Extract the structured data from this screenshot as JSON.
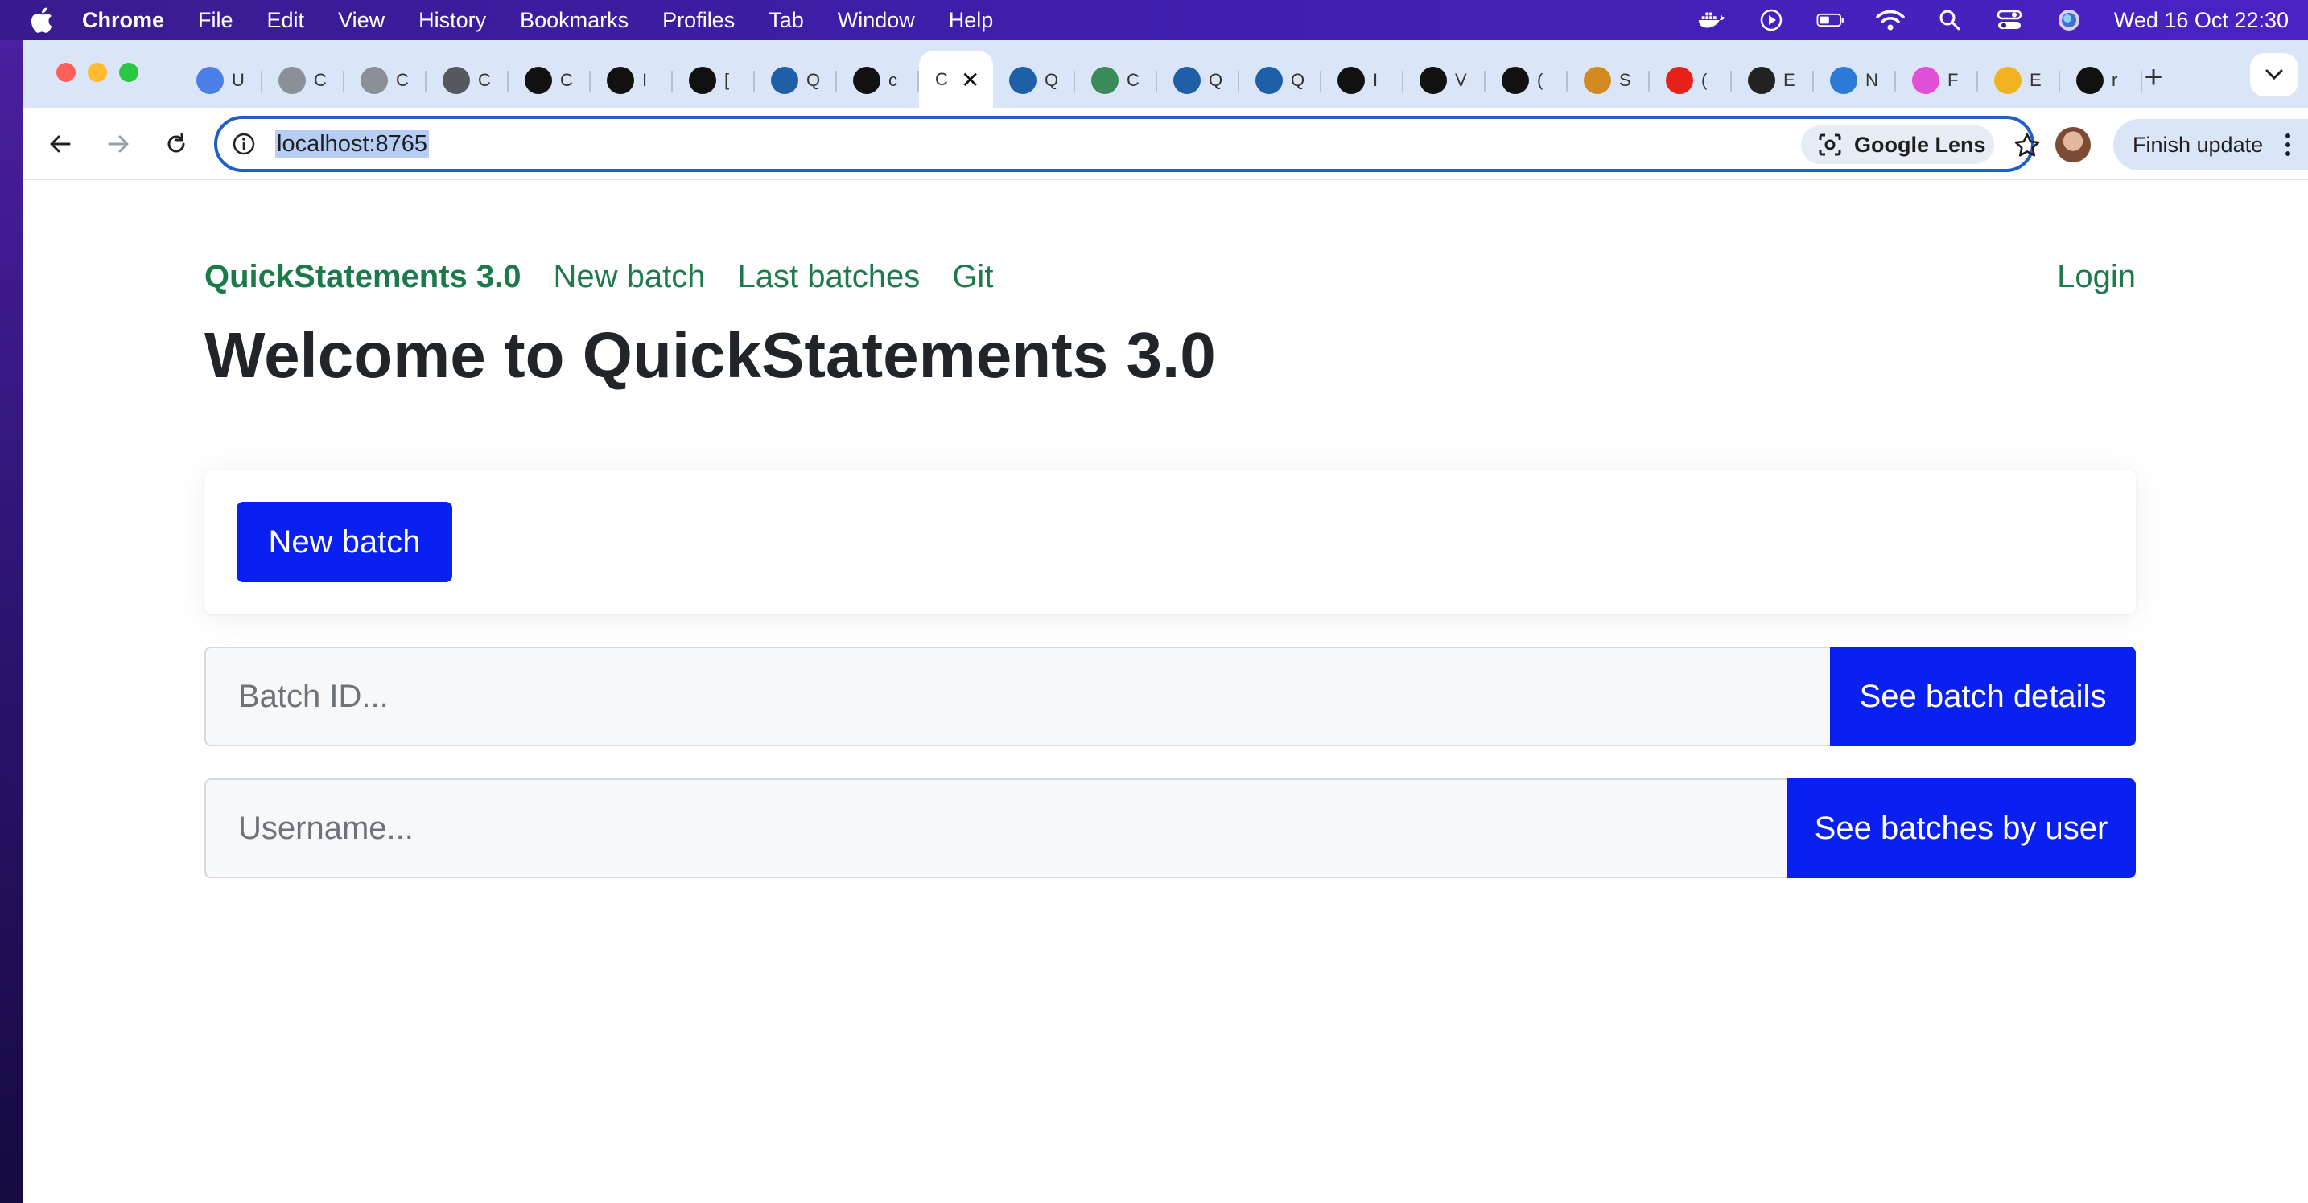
{
  "menubar": {
    "app": "Chrome",
    "items": [
      "File",
      "Edit",
      "View",
      "History",
      "Bookmarks",
      "Profiles",
      "Tab",
      "Window",
      "Help"
    ],
    "clock": "Wed 16 Oct  22:30"
  },
  "tabs": [
    {
      "icon": "docs-icon",
      "initial": "U",
      "color": "#4a7fe8"
    },
    {
      "icon": "globe-icon",
      "initial": "C",
      "color": "#8a8f98"
    },
    {
      "icon": "globe-icon",
      "initial": "C",
      "color": "#8a8f98"
    },
    {
      "icon": "globe-icon",
      "initial": "C",
      "color": "#55595f"
    },
    {
      "icon": "creative-commons-icon",
      "initial": "C",
      "color": "#111111"
    },
    {
      "icon": "github-icon",
      "initial": "I",
      "color": "#111111"
    },
    {
      "icon": "github-icon",
      "initial": "[",
      "color": "#111111"
    },
    {
      "icon": "wikidata-icon",
      "initial": "Q",
      "color": "#1f5fa8"
    },
    {
      "icon": "github-icon",
      "initial": "c",
      "color": "#111111"
    },
    {
      "icon": "active",
      "initial": "C",
      "color": "#ffffff"
    },
    {
      "icon": "wikidata-icon",
      "initial": "Q",
      "color": "#1f5fa8"
    },
    {
      "icon": "wikipedia-icon",
      "initial": "C",
      "color": "#3a8a5a"
    },
    {
      "icon": "wikidata-icon",
      "initial": "Q",
      "color": "#1f5fa8"
    },
    {
      "icon": "wikidata-icon",
      "initial": "Q",
      "color": "#1f5fa8"
    },
    {
      "icon": "github-icon",
      "initial": "I",
      "color": "#111111"
    },
    {
      "icon": "github-icon",
      "initial": "V",
      "color": "#111111"
    },
    {
      "icon": "github-icon",
      "initial": "(",
      "color": "#111111"
    },
    {
      "icon": "pencil-icon",
      "initial": "S",
      "color": "#d08a20"
    },
    {
      "icon": "youtube-icon",
      "initial": "(",
      "color": "#e62117"
    },
    {
      "icon": "openai-icon",
      "initial": "E",
      "color": "#222222"
    },
    {
      "icon": "edge-icon",
      "initial": "N",
      "color": "#2b7bd6"
    },
    {
      "icon": "figma-icon",
      "initial": "F",
      "color": "#e04fd6"
    },
    {
      "icon": "sparkle-icon",
      "initial": "E",
      "color": "#f1b420"
    },
    {
      "icon": "square-icon",
      "initial": "r",
      "color": "#111111"
    }
  ],
  "toolbar": {
    "url": "localhost:8765",
    "lens_label": "Google Lens",
    "finish_update_label": "Finish update"
  },
  "nav": {
    "brand": "QuickStatements 3.0",
    "links": [
      "New batch",
      "Last batches",
      "Git"
    ],
    "login": "Login"
  },
  "main": {
    "title": "Welcome to QuickStatements 3.0",
    "new_batch_button": "New batch",
    "batch_id_placeholder": "Batch ID...",
    "batch_details_button": "See batch details",
    "username_placeholder": "Username...",
    "batches_by_user_button": "See batches by user"
  },
  "colors": {
    "accent_blue": "#0a20f0",
    "nav_green": "#1e7a4a",
    "title_text": "#212529"
  }
}
